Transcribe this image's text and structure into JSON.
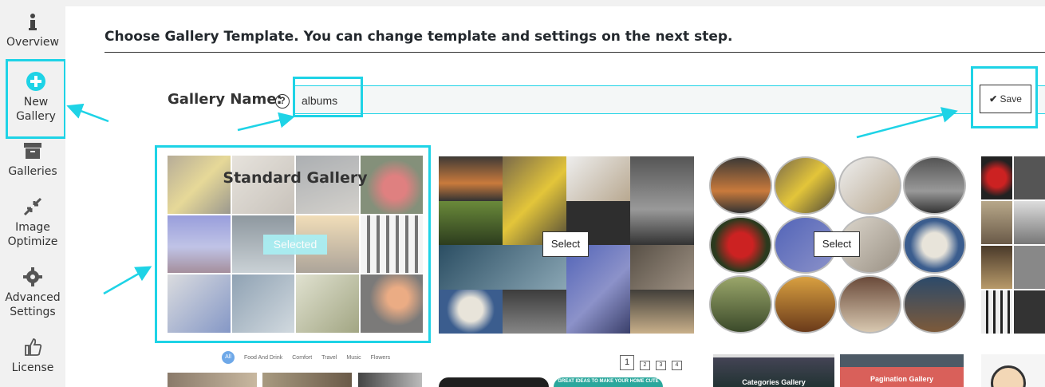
{
  "sidebar": {
    "items": [
      {
        "label_1": "Overview",
        "icon": "info-icon"
      },
      {
        "label_1": "New",
        "label_2": "Gallery",
        "icon": "plus-circle-icon",
        "active": true
      },
      {
        "label_1": "Galleries",
        "icon": "archive-icon"
      },
      {
        "label_1": "Image",
        "label_2": "Optimize",
        "icon": "compress-icon"
      },
      {
        "label_1": "Advanced",
        "label_2": "Settings",
        "icon": "gear-icon"
      },
      {
        "label_1": "License",
        "icon": "thumbs-up-icon"
      }
    ]
  },
  "main": {
    "heading": "Choose Gallery Template. You can change template and settings on the next step.",
    "gallery_name_label": "Gallery Name:",
    "help_label": "?",
    "gallery_name_value": "albums",
    "save_label": "Save"
  },
  "templates": {
    "standard": {
      "title": "Standard Gallery",
      "status": "Selected"
    },
    "mosaic": {
      "select_label": "Select"
    },
    "circle": {
      "select_label": "Select"
    }
  },
  "filters": [
    "All",
    "Food And Drink",
    "Comfort",
    "Travel",
    "Music",
    "Flowers"
  ],
  "pager": [
    "1",
    "2",
    "3",
    "4"
  ],
  "bottom_labels": {
    "categories": "Categories Gallery",
    "pagination": "Pagination Gallery",
    "banner": "GREAT IDEAS TO MAKE YOUR HOME CUTE"
  },
  "colors": {
    "highlight": "#1ed3e6",
    "selected_badge": "#a9eef2"
  }
}
